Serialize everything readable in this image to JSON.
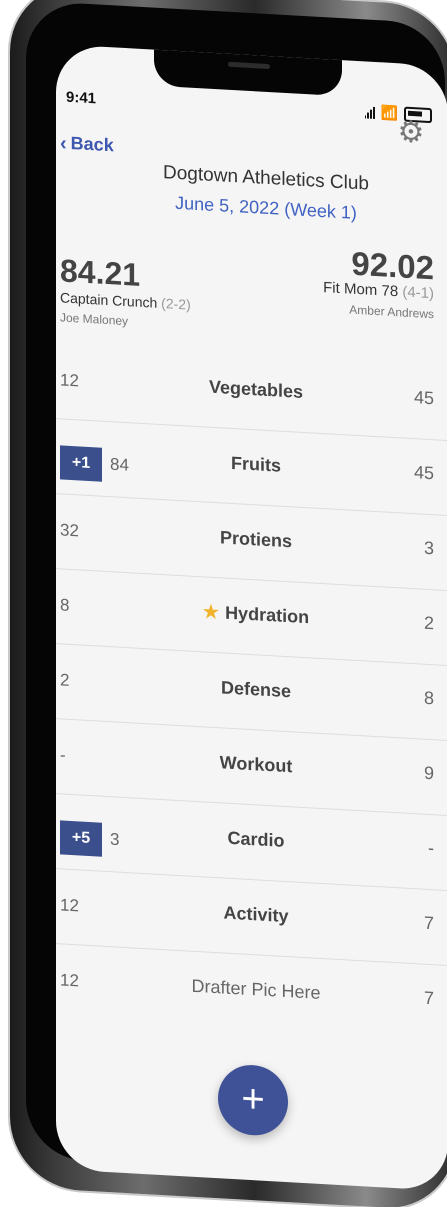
{
  "status": {
    "time": "9:41"
  },
  "header": {
    "back_label": "Back",
    "settings_icon": "gear-icon",
    "club_name": "Dogtown Atheletics Club",
    "date": "June 5, 2022 (Week 1)"
  },
  "matchup": {
    "left": {
      "score": "84.21",
      "team": "Captain Crunch",
      "record": "(2-2)",
      "owner": "Joe Maloney"
    },
    "right": {
      "score": "92.02",
      "team": "Fit Mom 78",
      "record": "(4-1)",
      "owner": "Amber Andrews"
    }
  },
  "categories": [
    {
      "name": "Vegetables",
      "left": "12",
      "right": "45",
      "badge": ""
    },
    {
      "name": "Fruits",
      "left": "84",
      "right": "45",
      "badge": "+1"
    },
    {
      "name": "Protiens",
      "left": "32",
      "right": "3",
      "badge": ""
    },
    {
      "name": "Hydration",
      "left": "8",
      "right": "2",
      "badge": "",
      "starred": true
    },
    {
      "name": "Defense",
      "left": "2",
      "right": "8",
      "badge": ""
    },
    {
      "name": "Workout",
      "left": "-",
      "right": "9",
      "badge": ""
    },
    {
      "name": "Cardio",
      "left": "3",
      "right": "-",
      "badge": "+5"
    },
    {
      "name": "Activity",
      "left": "12",
      "right": "7",
      "badge": ""
    },
    {
      "name": "Drafter Pic Here",
      "left": "12",
      "right": "7",
      "badge": ""
    }
  ],
  "fab": {
    "label": "+"
  },
  "colors": {
    "accent": "#4062c2",
    "badge": "#3b4f8d",
    "star": "#f1b32c"
  }
}
